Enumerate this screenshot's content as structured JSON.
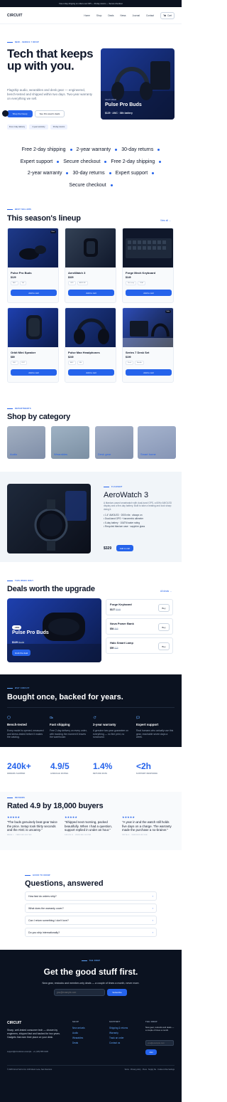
{
  "topbar": {
    "text": "Free 2-day shipping on orders over $75 — 30-day returns — Secure checkout"
  },
  "brand": {
    "logo": "CIRCUIT"
  },
  "nav": {
    "links": [
      "Home",
      "Shop",
      "Deals",
      "News",
      "Journal",
      "Contact"
    ],
    "cart": "Cart"
  },
  "hero": {
    "kicker": "NEW · SERIES 7 DROP",
    "title": "Tech that keeps up with you.",
    "body": "Flagship audio, wearables and desk gear — engineered, bench-tested and shipped within two days. Two-year warranty on everything we sell.",
    "cta_primary": "Shop the lineup",
    "cta_secondary": "See this week's deals",
    "chips": [
      "Free 2-day delivery",
      "2-year warranty",
      "30-day returns"
    ],
    "product_kicker": "FEATURED",
    "product_name": "Pulse Pro Buds",
    "product_meta": "$129 · ANC · 36h battery"
  },
  "marquee": {
    "items": [
      "Free 2-day shipping",
      "2-year warranty",
      "30-day returns",
      "Expert support",
      "Secure checkout",
      "Free 2-day shipping",
      "2-year warranty",
      "30-day returns",
      "Expert support",
      "Secure checkout"
    ]
  },
  "lineup": {
    "kicker": "BEST SELLERS",
    "title": "This season's lineup",
    "view_all": "View all →",
    "add_label": "Add to cart",
    "products": [
      {
        "name": "Pulse Pro Buds",
        "price": "$129",
        "badge": "New",
        "tags": [
          "ANC",
          "36h"
        ]
      },
      {
        "name": "AeroWatch 3",
        "price": "$329",
        "badge": "",
        "tags": [
          "GPS",
          "AMOLED"
        ]
      },
      {
        "name": "Forge Mech Keyboard",
        "price": "$149",
        "badge": "",
        "tags": [
          "Hot-swap",
          "RGB"
        ]
      },
      {
        "name": "Orbit Mini Speaker",
        "price": "$89",
        "badge": "",
        "tags": [
          "360°",
          "IP67"
        ]
      },
      {
        "name": "Pulse Max Headphones",
        "price": "$249",
        "badge": "",
        "tags": [
          "ANC",
          "40h"
        ]
      },
      {
        "name": "Series 7 Desk Set",
        "price": "$199",
        "badge": "Sale",
        "tags": [
          "Desk",
          "Bundle"
        ]
      }
    ]
  },
  "categories": {
    "kicker": "DEPARTMENTS",
    "title": "Shop by category",
    "items": [
      "Audio",
      "Wearables",
      "Desk gear",
      "Smart home"
    ]
  },
  "spotlight": {
    "kicker": "FLAGSHIP",
    "title": "AeroWatch 3",
    "body": "A titanium-cased smartwatch with dual-band GPS, a 60Hz AMOLED display and a five-day battery. Built to take a beating and look sharp doing it.",
    "bullets": [
      "1.4\" AMOLED · 2000 nits · always on",
      "Dual-band GPS + barometric altimeter",
      "5-day battery · 10ATM water rating",
      "Recycled titanium case · sapphire glass"
    ],
    "price": "$329",
    "cta": "Add to cart"
  },
  "deals": {
    "kicker": "THIS WEEK ONLY",
    "title": "Deals worth the upgrade",
    "view_all": "All deals →",
    "feature": {
      "badge": "−26%",
      "name": "Pulse Pro Buds",
      "price": "$129",
      "old": "$179",
      "cta": "Grab the deal"
    },
    "items": [
      {
        "name": "Forge Keyboard",
        "price": "$127",
        "old": "$149",
        "cta": "Buy"
      },
      {
        "name": "Nova Power Bank",
        "price": "$54",
        "old": "$69",
        "cta": "Buy"
      },
      {
        "name": "Halo Smart Lamp",
        "price": "$59",
        "old": "$79",
        "cta": "Buy"
      }
    ]
  },
  "promise": {
    "kicker": "WHY CIRCUIT",
    "title": "Bought once, backed for years.",
    "features": [
      {
        "title": "Bench-tested",
        "text": "Every model is opened, measured and stress-tested before it makes the catalog."
      },
      {
        "title": "Fast shipping",
        "text": "Free 2-day delivery on every order, with tracking the moment it leaves the warehouse."
      },
      {
        "title": "2-year warranty",
        "text": "A genuine two-year guarantee on everything — no fine print, no runaround."
      },
      {
        "title": "Expert support",
        "text": "Real humans who actually use this gear, reachable seven days a week."
      }
    ]
  },
  "stats": [
    {
      "n": "240k+",
      "l": "ORDERS SHIPPED"
    },
    {
      "n": "4.9/5",
      "l": "AVERAGE RATING"
    },
    {
      "n": "1.4%",
      "l": "RETURN RATE"
    },
    {
      "n": "<2h",
      "l": "SUPPORT RESPONSE"
    }
  ],
  "reviews": {
    "kicker": "REVIEWS",
    "title": "Rated 4.9 by 18,000 buyers",
    "items": [
      {
        "stars": "★★★★★",
        "text": "\"The buds genuinely beat gear twice the price. Setup took thirty seconds and the ANC is uncanny.\"",
        "author": "MAYA L · VERIFIED BUYER"
      },
      {
        "stars": "★★★★★",
        "text": "\"Shipped next morning, packed beautifully. When I had a question, support replied in under an hour.\"",
        "author": "DEVON R · VERIFIED BUYER"
      },
      {
        "stars": "★★★★★",
        "text": "\"A year in and the watch still holds five days on a charge. The warranty made the purchase a no-brainer.\"",
        "author": "PRIYA S · VERIFIED BUYER"
      }
    ]
  },
  "faq": {
    "kicker": "GOOD TO KNOW",
    "title": "Questions, answered",
    "items": [
      "How fast do orders ship?",
      "What does the warranty cover?",
      "Can I return something I don't love?",
      "Do you ship internationally?"
    ]
  },
  "newsletter": {
    "kicker": "THE DROP",
    "title": "Get the good stuff first.",
    "body": "New gear, restocks and member-only deals — a couple of times a month, never more.",
    "placeholder": "you@example.com",
    "cta": "Subscribe"
  },
  "footer": {
    "logo": "CIRCUIT",
    "about": "Sharp, well-tested consumer tech — chosen by engineers, shipped fast and backed for two years. Gadgets that earn their place on your desk.",
    "contact": "support@circuitstore.example · +1 (415) 555 0136",
    "cols": [
      {
        "title": "SHOP",
        "links": [
          "New arrivals",
          "Audio",
          "Wearables",
          "Deals"
        ]
      },
      {
        "title": "SUPPORT",
        "links": [
          "Shipping & returns",
          "Warranty",
          "Track an order",
          "Contact us"
        ]
      }
    ],
    "news_title": "THE DROP",
    "news_text": "New gear, restocks and deals — a couple of times a month.",
    "news_placeholder": "you@example.com",
    "news_cta": "Join",
    "copyright": "© 2025 Circuit Tech & Co. 109 Folsom Lane, San Francisco",
    "legal": "Terms · Privacy policy · Press · Supply file · Cookie & Site Settings"
  }
}
